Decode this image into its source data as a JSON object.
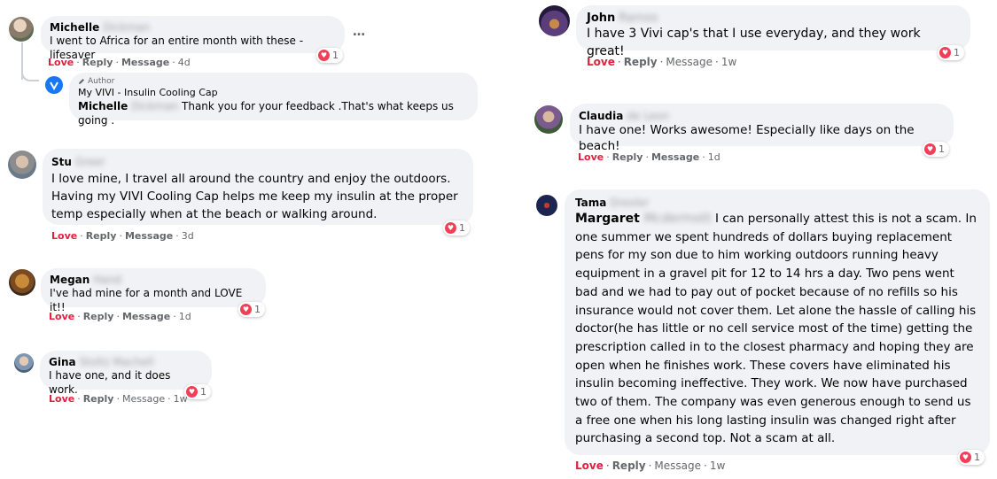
{
  "colors": {
    "love": "#e41e3f",
    "bubble": "#f0f2f5",
    "heart": "#f33e58",
    "vivi_blue": "#1877f2"
  },
  "comments_left": [
    {
      "first": "Michelle",
      "last": "Dickman",
      "text": "I went to Africa for an entire month with these - lifesaver",
      "love": "Love",
      "reply": "Reply",
      "message": "Message",
      "age": "4d",
      "reactions": "1",
      "more": "…"
    },
    {
      "first": "Stu",
      "last": "Greer",
      "text": "I love mine, I travel all around the country and enjoy the outdoors. Having my VIVI Cooling Cap helps me keep my insulin at the proper temp especially when at the beach or walking around.",
      "love": "Love",
      "reply": "Reply",
      "message": "Message",
      "age": "3d",
      "reactions": "1"
    },
    {
      "first": "Megan",
      "last": "Hand",
      "text": "I've had mine for a month and LOVE it!!",
      "love": "Love",
      "reply": "Reply",
      "message": "Message",
      "age": "1d",
      "reactions": "1"
    },
    {
      "first": "Gina",
      "last": "Stoltz Machell",
      "text": "I have one, and it does work.",
      "love": "Love",
      "reply": "Reply",
      "message": "Message",
      "age": "1w",
      "reactions": "1"
    }
  ],
  "author_reply": {
    "badge": "Author",
    "page_name": "My VIVI - Insulin Cooling Cap",
    "mention_first": "Michelle",
    "mention_last": "Dickman",
    "text": "Thank you for your feedback .That's what keeps us going ."
  },
  "comments_right": [
    {
      "first": "John",
      "last": "Ramos",
      "text": "I have 3 Vivi cap's that I use everyday, and they work great!",
      "love": "Love",
      "reply": "Reply",
      "message": "Message",
      "age": "1w",
      "reactions": "1"
    },
    {
      "first": "Claudia",
      "last": "de Leon",
      "text": "I have one! Works awesome! Especially like days on the beach!",
      "love": "Love",
      "reply": "Reply",
      "message": "Message",
      "age": "1d",
      "reactions": "1"
    },
    {
      "first": "Tama",
      "last": "Drexler",
      "mention_first": "Margaret",
      "mention_last": "Mcdermott",
      "text": "I can personally attest this is not a scam. In one summer we spent hundreds of dollars buying replacement pens for my son due to him working outdoors running heavy equipment in a gravel pit for 12 to 14 hrs a day. Two pens went bad and we had to pay out of pocket because of no refills so his insurance would not cover them. Let alone the hassle of calling his doctor(he has little or no cell service most of the time) getting the prescription called in to the closest pharmacy and hoping they are open when he finishes work. These covers have eliminated his insulin becoming ineffective. They work. We now have purchased two of them. The company was even generous enough to send us a free one when his long lasting insulin was changed right after purchasing a second top. Not a scam at all.",
      "love": "Love",
      "reply": "Reply",
      "message": "Message",
      "age": "1w",
      "reactions": "1"
    }
  ]
}
